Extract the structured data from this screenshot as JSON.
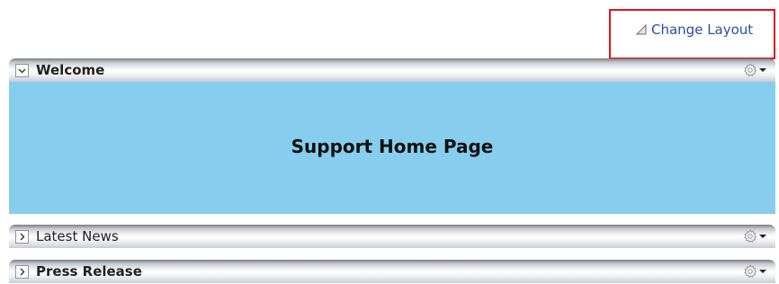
{
  "toolbar": {
    "change_layout_label": "Change Layout",
    "change_layout_icon": "triangle-icon"
  },
  "colors": {
    "highlight_border": "#e0111c",
    "link": "#2a4f9e",
    "content_bg": "#86cdee"
  },
  "panels": [
    {
      "title": "Welcome",
      "expanded": true,
      "toggle_icon": "chevron-down-icon",
      "actions_icon": "gear-icon",
      "content": {
        "heading": "Support Home Page"
      }
    },
    {
      "title": "Latest News",
      "expanded": false,
      "toggle_icon": "chevron-right-icon",
      "actions_icon": "gear-icon"
    },
    {
      "title": "Press Release",
      "expanded": false,
      "toggle_icon": "chevron-right-icon",
      "actions_icon": "gear-icon"
    }
  ]
}
